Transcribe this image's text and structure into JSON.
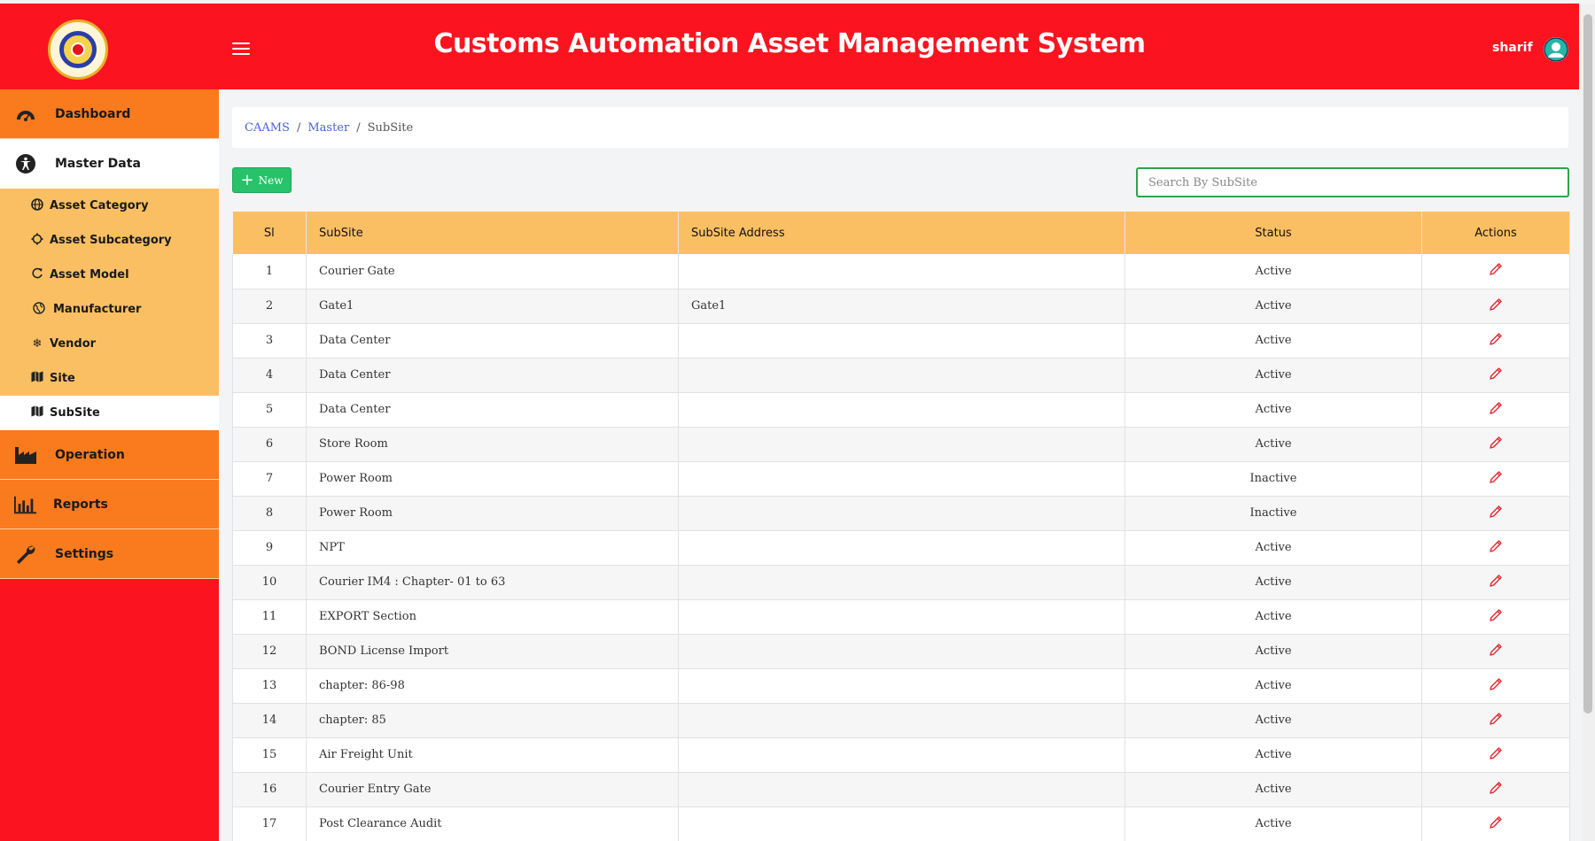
{
  "header": {
    "title": "Customs Automation Asset Management System",
    "user_name": "sharif",
    "colors": {
      "header_bg": "#fb141f",
      "accent_orange": "#fa7a1e",
      "submenu_bg": "#fbbf63",
      "new_button": "#28c26a"
    }
  },
  "sidebar": {
    "main_items": [
      {
        "label": "Dashboard",
        "icon": "gauge-icon"
      },
      {
        "label": "Master Data",
        "icon": "accessibility-icon"
      },
      {
        "label": "Operation",
        "icon": "factory-icon"
      },
      {
        "label": "Reports",
        "icon": "bar-chart-icon"
      },
      {
        "label": "Settings",
        "icon": "wrench-icon"
      }
    ],
    "sub_items": [
      {
        "label": "Asset Category",
        "icon": "globe-icon"
      },
      {
        "label": "Asset Subcategory",
        "icon": "gear-icon"
      },
      {
        "label": "Asset Model",
        "icon": "refresh-icon"
      },
      {
        "label": "Manufacturer",
        "icon": "earth-icon"
      },
      {
        "label": "Vendor",
        "icon": "snowflake-icon"
      },
      {
        "label": "Site",
        "icon": "map-icon"
      },
      {
        "label": "SubSite",
        "icon": "map-icon"
      }
    ]
  },
  "breadcrumb": {
    "root": "CAAMS",
    "middle": "Master",
    "current": "SubSite"
  },
  "toolbar": {
    "new_label": "New",
    "search_placeholder": "Search By SubSite"
  },
  "table": {
    "headers": {
      "sl": "Sl",
      "subsite": "SubSite",
      "address": "SubSite Address",
      "status": "Status",
      "actions": "Actions"
    },
    "rows": [
      {
        "sl": "1",
        "subsite": "Courier Gate",
        "address": "",
        "status": "Active"
      },
      {
        "sl": "2",
        "subsite": "Gate1",
        "address": "Gate1",
        "status": "Active"
      },
      {
        "sl": "3",
        "subsite": "Data Center",
        "address": "",
        "status": "Active"
      },
      {
        "sl": "4",
        "subsite": "Data Center",
        "address": "",
        "status": "Active"
      },
      {
        "sl": "5",
        "subsite": "Data Center",
        "address": "",
        "status": "Active"
      },
      {
        "sl": "6",
        "subsite": "Store Room",
        "address": "",
        "status": "Active"
      },
      {
        "sl": "7",
        "subsite": "Power Room",
        "address": "",
        "status": "Inactive"
      },
      {
        "sl": "8",
        "subsite": "Power Room",
        "address": "",
        "status": "Inactive"
      },
      {
        "sl": "9",
        "subsite": "NPT",
        "address": "",
        "status": "Active"
      },
      {
        "sl": "10",
        "subsite": "Courier IM4 : Chapter- 01 to 63",
        "address": "",
        "status": "Active"
      },
      {
        "sl": "11",
        "subsite": "EXPORT Section",
        "address": "",
        "status": "Active"
      },
      {
        "sl": "12",
        "subsite": "BOND License Import",
        "address": "",
        "status": "Active"
      },
      {
        "sl": "13",
        "subsite": "chapter: 86-98",
        "address": "",
        "status": "Active"
      },
      {
        "sl": "14",
        "subsite": "chapter: 85",
        "address": "",
        "status": "Active"
      },
      {
        "sl": "15",
        "subsite": "Air Freight Unit",
        "address": "",
        "status": "Active"
      },
      {
        "sl": "16",
        "subsite": "Courier Entry Gate",
        "address": "",
        "status": "Active"
      },
      {
        "sl": "17",
        "subsite": "Post Clearance Audit",
        "address": "",
        "status": "Active"
      }
    ]
  }
}
